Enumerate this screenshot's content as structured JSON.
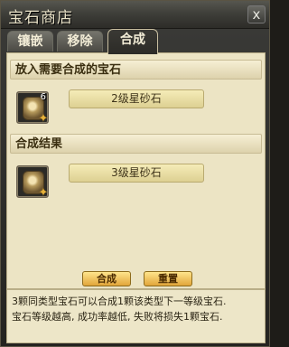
{
  "window": {
    "title": "宝石商店",
    "close_glyph": "x"
  },
  "tabs": [
    {
      "label": "镶嵌",
      "active": false
    },
    {
      "label": "移除",
      "active": false
    },
    {
      "label": "合成",
      "active": true
    }
  ],
  "input_section": {
    "heading": "放入需要合成的宝石",
    "slot": {
      "icon": "gem-icon",
      "count": "6",
      "item_name": "2级星砂石"
    }
  },
  "result_section": {
    "heading": "合成结果",
    "slot": {
      "icon": "gem-icon",
      "item_name": "3级星砂石"
    }
  },
  "buttons": {
    "compose": "合成",
    "reset": "重置"
  },
  "description": [
    "3颗同类型宝石可以合成1颗该类型下一等级宝石.",
    "宝石等级越高, 成功率越低, 失败将损失1颗宝石."
  ],
  "colors": {
    "accent_button": "#f0c460",
    "panel_bg": "#ece4c4"
  }
}
